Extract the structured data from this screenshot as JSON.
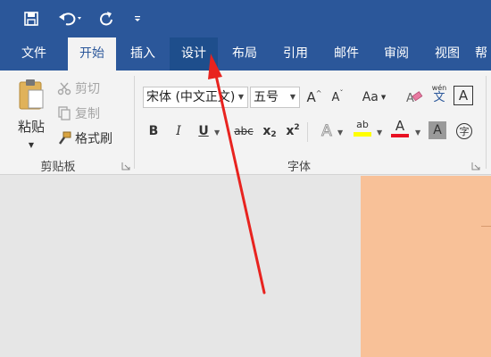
{
  "quick_access": {
    "save_icon": "save-icon",
    "undo_icon": "undo-icon",
    "redo_icon": "repeat-icon",
    "customize_icon": "customize-qat-icon"
  },
  "tabs": [
    {
      "label": "文件"
    },
    {
      "label": "开始"
    },
    {
      "label": "插入"
    },
    {
      "label": "设计"
    },
    {
      "label": "布局"
    },
    {
      "label": "引用"
    },
    {
      "label": "邮件"
    },
    {
      "label": "审阅"
    },
    {
      "label": "视图"
    },
    {
      "label": "帮"
    }
  ],
  "clipboard": {
    "paste_label": "粘贴",
    "cut_label": "剪切",
    "copy_label": "复制",
    "format_painter_label": "格式刷",
    "group_label": "剪贴板"
  },
  "font": {
    "font_name": "宋体 (中文正文)",
    "font_size": "五号",
    "group_label": "字体",
    "grow_label": "A",
    "shrink_label": "A",
    "change_case_label": "Aa",
    "phonetic_top": "wén",
    "phonetic_bottom": "文",
    "char_border_label": "A",
    "bold_label": "B",
    "italic_label": "I",
    "underline_label": "U",
    "strike_label": "abc",
    "subscript_base": "x",
    "subscript_sub": "2",
    "superscript_base": "x",
    "superscript_sup": "2",
    "text_effects_label": "A",
    "highlight_label": "ab",
    "font_color_label": "A",
    "char_shading_label": "A",
    "enclose_label": "字"
  },
  "colors": {
    "ribbon_blue": "#2b579a",
    "highlight_yellow": "#ffff00",
    "font_color_red": "#e81123",
    "page_color": "#f8c198",
    "arrow_red": "#e8231f"
  }
}
